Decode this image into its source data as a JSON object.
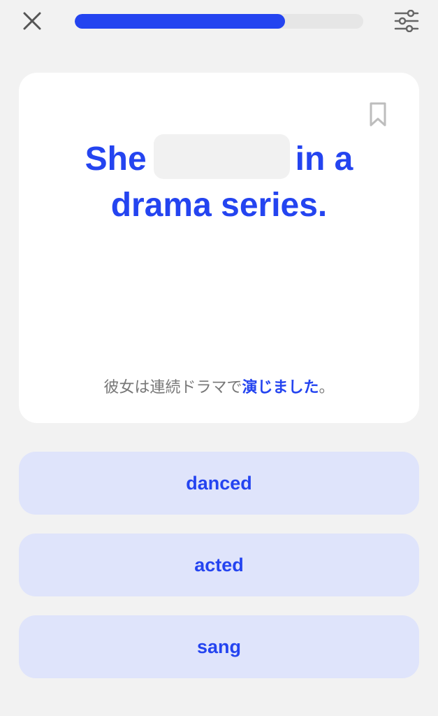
{
  "header": {
    "close_icon": "close-x-icon",
    "settings_icon": "sliders-icon",
    "progress_fraction": 0.73
  },
  "card": {
    "bookmark_icon": "bookmark-outline-icon",
    "sentence_before": "She",
    "sentence_after_line1": "in a",
    "sentence_line2": "drama series.",
    "translation_prefix": "彼女は連続ドラマで",
    "translation_highlight": "演じました",
    "translation_suffix": "。"
  },
  "options": [
    {
      "label": "danced"
    },
    {
      "label": "acted"
    },
    {
      "label": "sang"
    }
  ],
  "colors": {
    "accent": "#2444f0",
    "option_bg": "#dfe4fb",
    "background": "#f2f2f2"
  }
}
